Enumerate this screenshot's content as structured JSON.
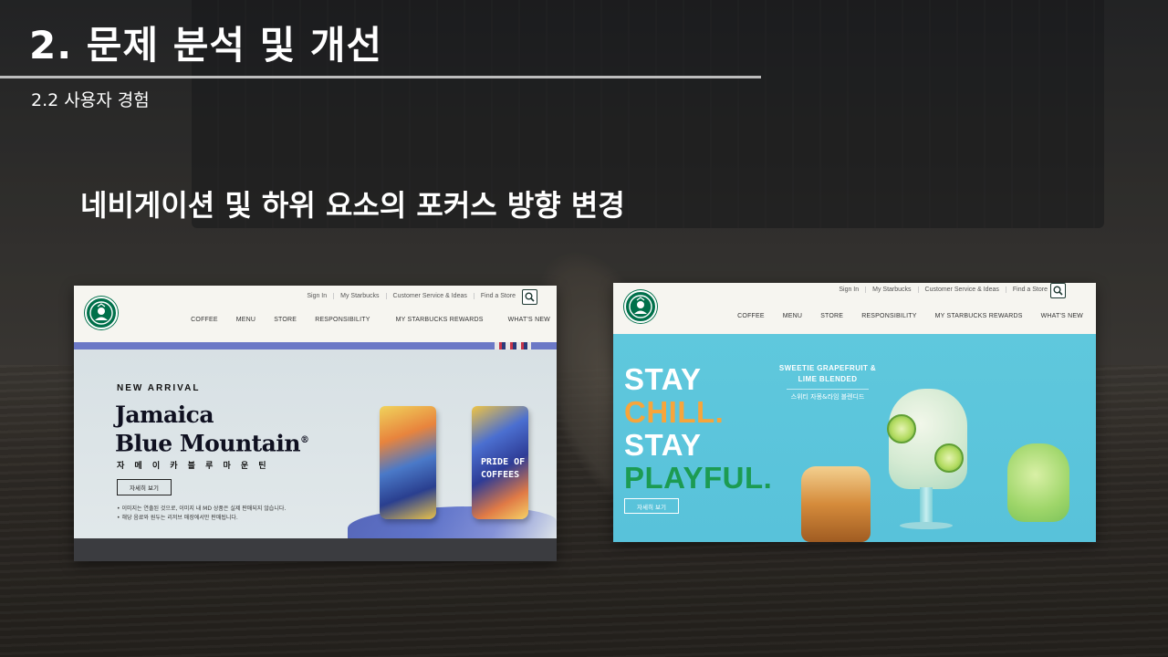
{
  "slide": {
    "title": "2. 문제 분석 및 개선",
    "subtitle": "2.2  사용자 경험",
    "heading": "네비게이션 및 하위 요소의 포커스 방향 변경"
  },
  "colors": {
    "starbucks_green": "#00704a",
    "nav_band": "#6b78c6",
    "hero_teal": "#5fc8dd",
    "accent_orange": "#f7a53b",
    "accent_green": "#1c9b52"
  },
  "screenshot_left": {
    "utility_links": [
      "Sign In",
      "My Starbucks",
      "Customer Service & Ideas",
      "Find a Store"
    ],
    "search_icon": "search-icon",
    "nav": [
      "COFFEE",
      "MENU",
      "STORE",
      "RESPONSIBILITY",
      "MY STARBUCKS REWARDS",
      "WHAT'S NEW"
    ],
    "label": "NEW ARRIVAL",
    "product_line1": "Jamaica",
    "product_line2": "Blue Mountain",
    "product_mark": "®",
    "product_kr": "자 메 이 카 블 루 마 운 틴",
    "button": "자세히 보기",
    "note1": "• 이미지는 연출된 것으로, 이미지 내 MD 상품은 실제 판매되지 않습니다.",
    "note2": "• 해당 음료와 원두는 리저브 매장에서만 판매됩니다.",
    "cup_text_line1": "PRIDE OF",
    "cup_text_line2": "COFFEES"
  },
  "screenshot_right": {
    "utility_links": [
      "Sign In",
      "My Starbucks",
      "Customer Service & Ideas",
      "Find a Store"
    ],
    "search_icon": "search-icon",
    "nav": [
      "COFFEE",
      "MENU",
      "STORE",
      "RESPONSIBILITY",
      "MY STARBUCKS REWARDS",
      "WHAT'S NEW"
    ],
    "slogan": [
      "STAY",
      "CHILL.",
      "STAY",
      "PLAYFUL."
    ],
    "menu_en_line1": "SWEETIE GRAPEFRUIT &",
    "menu_en_line2": "LIME BLENDED",
    "menu_kr": "스위티 자몽&라임 블렌디드",
    "button": "자세히 보기"
  }
}
